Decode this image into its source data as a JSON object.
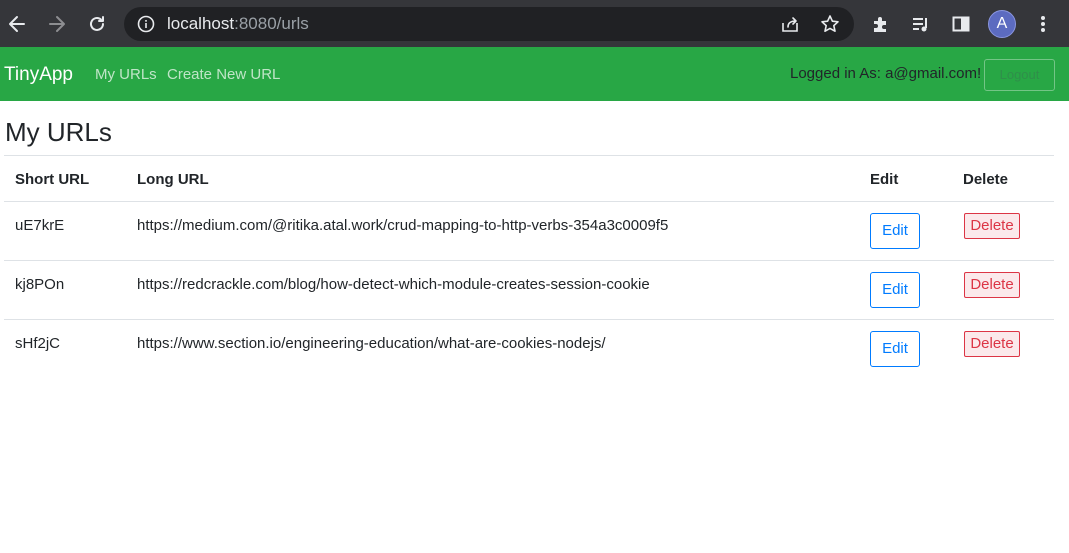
{
  "browser": {
    "url_host": "localhost",
    "url_rest": ":8080/urls",
    "avatar_letter": "A"
  },
  "navbar": {
    "brand": "TinyApp",
    "links": [
      "My URLs",
      "Create New URL"
    ],
    "logged_in_text": "Logged in As: a@gmail.com!",
    "logout_label": "Logout"
  },
  "main": {
    "title": "My URLs",
    "table": {
      "headers": [
        "Short URL",
        "Long URL",
        "Edit",
        "Delete"
      ],
      "rows": [
        {
          "short": "uE7krE",
          "long": "https://medium.com/@ritika.atal.work/crud-mapping-to-http-verbs-354a3c0009f5",
          "edit": "Edit",
          "delete": "Delete"
        },
        {
          "short": "kj8POn",
          "long": "https://redcrackle.com/blog/how-detect-which-module-creates-session-cookie",
          "edit": "Edit",
          "delete": "Delete"
        },
        {
          "short": "sHf2jC",
          "long": "https://www.section.io/engineering-education/what-are-cookies-nodejs/",
          "edit": "Edit",
          "delete": "Delete"
        }
      ]
    }
  },
  "colors": {
    "navbar_bg": "#28a745",
    "edit_accent": "#007bff",
    "delete_accent": "#dc3545"
  }
}
